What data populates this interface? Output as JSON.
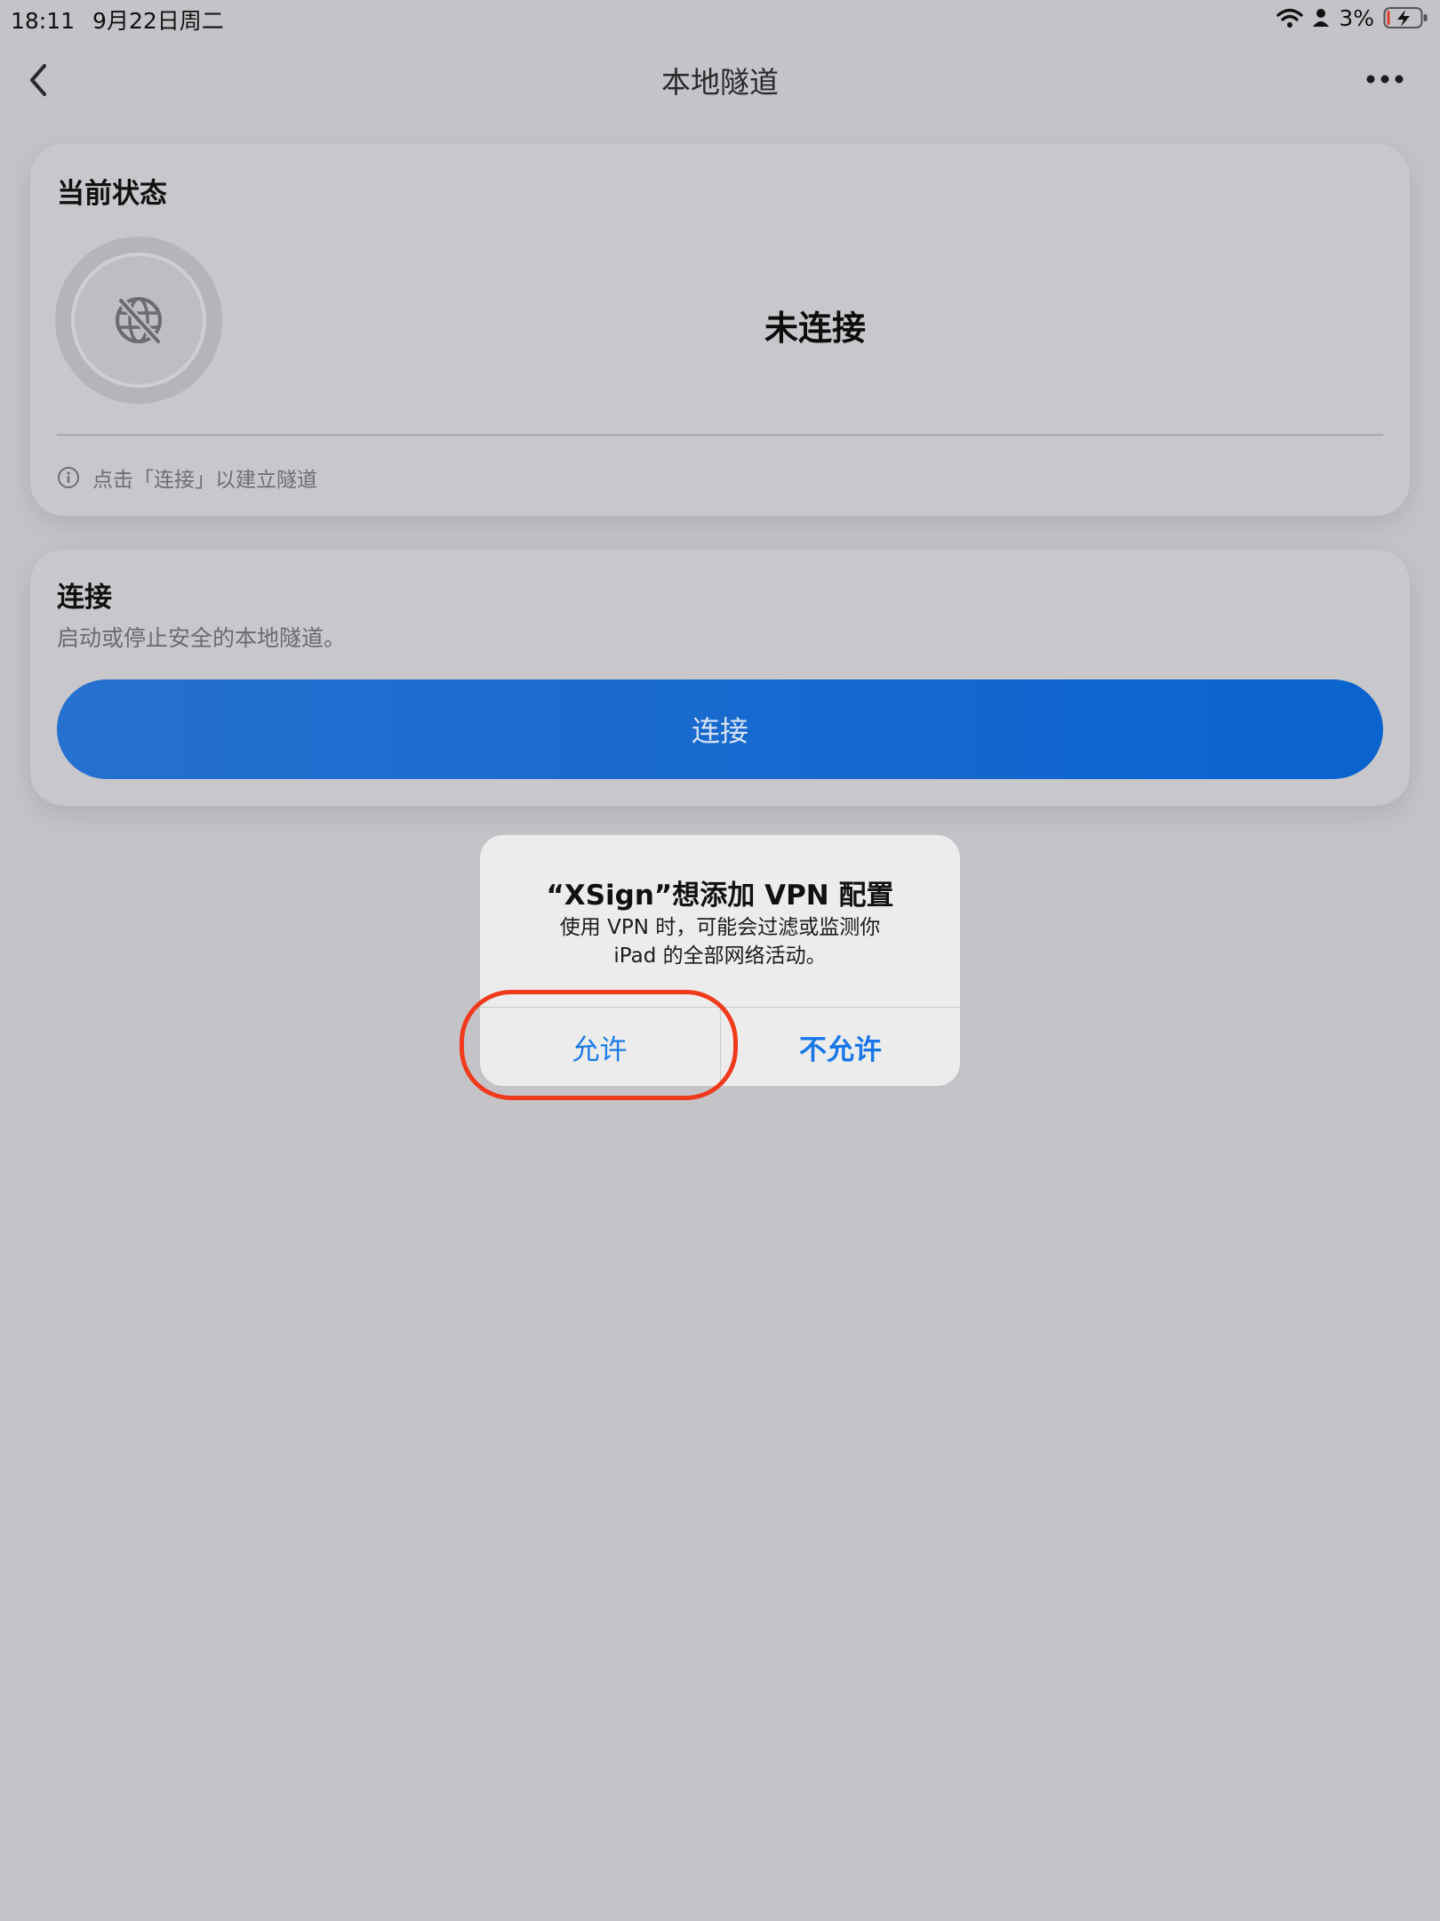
{
  "status_bar": {
    "time": "18:11",
    "date": "9月22日周二",
    "battery": "3%",
    "icons": [
      "wifi-icon",
      "person-icon",
      "battery-charging-icon"
    ]
  },
  "nav": {
    "title": "本地隧道",
    "back_icon": "chevron-left-icon",
    "more_icon": "ellipsis-icon"
  },
  "status_card": {
    "title": "当前状态",
    "state": "未连接",
    "state_icon": "globe-slash-icon",
    "hint": "点击「连接」以建立隧道",
    "hint_icon": "info-icon"
  },
  "connect_card": {
    "title": "连接",
    "subtitle": "启动或停止安全的本地隧道。",
    "button_label": "连接"
  },
  "alert": {
    "title": "“XSign”想添加 VPN 配置",
    "message_line1": "使用 VPN 时，可能会过滤或监测你",
    "message_line2": "iPad 的全部网络活动。",
    "allow_label": "允许",
    "deny_label": "不允许"
  },
  "colors": {
    "background": "#c4c3c8",
    "accent": "#0a63cf",
    "alert_button": "#1a7ae8",
    "highlight": "#f03a1c"
  }
}
